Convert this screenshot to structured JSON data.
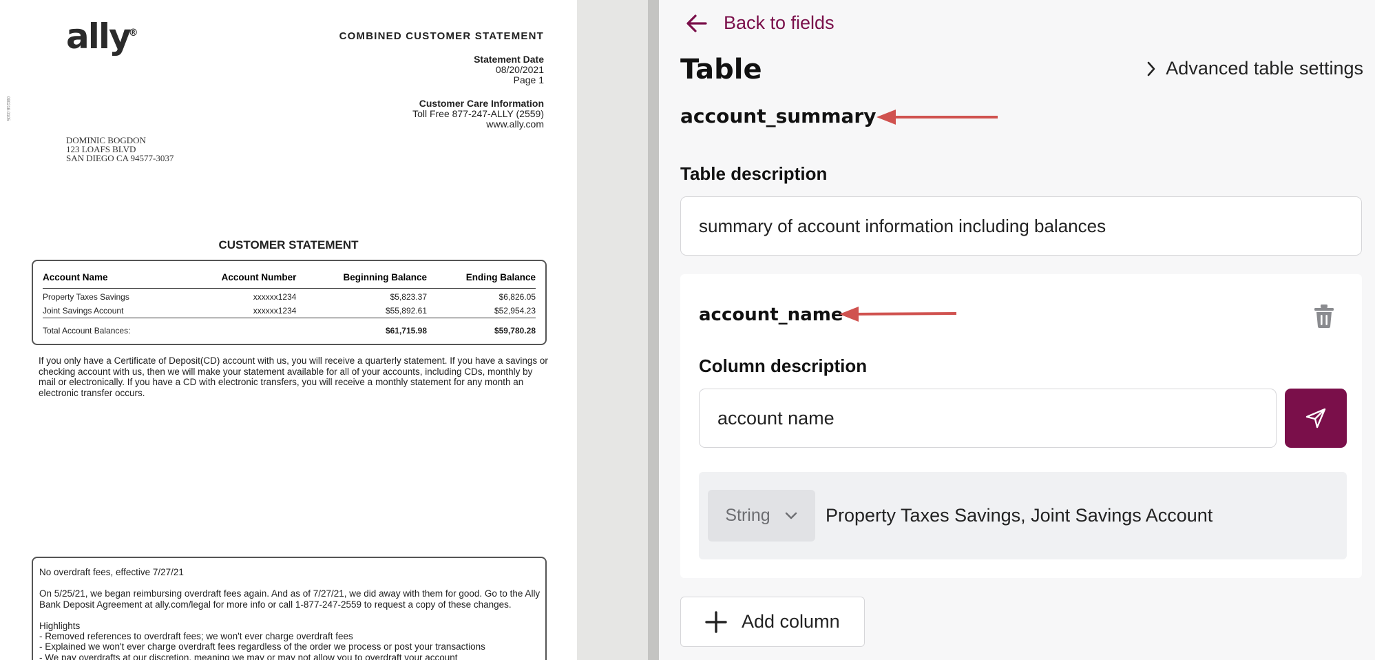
{
  "document": {
    "logo_text": "ally",
    "title": "COMBINED CUSTOMER STATEMENT",
    "statement_date_label": "Statement Date",
    "statement_date": "08/20/2021",
    "page": "Page 1",
    "care_label": "Customer Care Information",
    "care_phone": "Toll Free 877-247-ALLY (2559)",
    "care_web": "www.ally.com",
    "side_code": "090218-0105",
    "address": [
      "DOMINIC BOGDON",
      "123 LOAFS BLVD",
      "SAN DIEGO CA  94577-3037"
    ],
    "section_heading": "CUSTOMER STATEMENT",
    "accounts_table": {
      "headers": [
        "Account Name",
        "Account Number",
        "Beginning Balance",
        "Ending Balance"
      ],
      "rows": [
        [
          "Property Taxes Savings",
          "xxxxxx1234",
          "$5,823.37",
          "$6,826.05"
        ],
        [
          "Joint Savings Account",
          "xxxxxx1234",
          "$55,892.61",
          "$52,954.23"
        ]
      ],
      "total": [
        "Total Account Balances:",
        "",
        "$61,715.98",
        "$59,780.28"
      ]
    },
    "cd_note": "If you only have a Certificate of Deposit(CD) account with us, you will receive a quarterly statement.  If you have a savings or checking account with us, then we will make your statement available for all of your accounts, including CDs, monthly by mail or electronically.  If you have a CD with electronic transfers, you will receive a monthly statement for any month an electronic transfer occurs.",
    "notice": {
      "title": "No overdraft fees, effective 7/27/21",
      "body": "On 5/25/21, we began reimbursing overdraft fees again. And as of 7/27/21, we did away with them for good. Go to the Ally Bank Deposit Agreement at ally.com/legal for more info or call 1-877-247-2559 to request a copy of these changes.",
      "highlights_label": "Highlights",
      "highlights": [
        " - Removed references to overdraft fees; we won't ever charge overdraft fees",
        " - Explained we won't ever charge overdraft fees regardless of the order we process or post your transactions",
        " - We pay overdrafts at our discretion, meaning we may or may not allow you to overdraft your account"
      ]
    }
  },
  "panel": {
    "back_label": "Back to fields",
    "heading": "Table",
    "advanced_label": "Advanced table settings",
    "table_name": "account_summary",
    "description_label": "Table description",
    "description_value": "summary of account information including balances",
    "column": {
      "name": "account_name",
      "description_label": "Column description",
      "description_value": "account name",
      "type": "String",
      "examples": "Property Taxes Savings, Joint Savings Account"
    },
    "add_column_label": "Add column"
  },
  "colors": {
    "brand": "#7a0f4a",
    "annotation_arrow": "#d0524f",
    "panel_bg": "#f7f7f8"
  },
  "icons": [
    "arrow-left-icon",
    "chevron-right-icon",
    "trash-icon",
    "send-icon",
    "chevron-down-icon",
    "plus-icon"
  ]
}
